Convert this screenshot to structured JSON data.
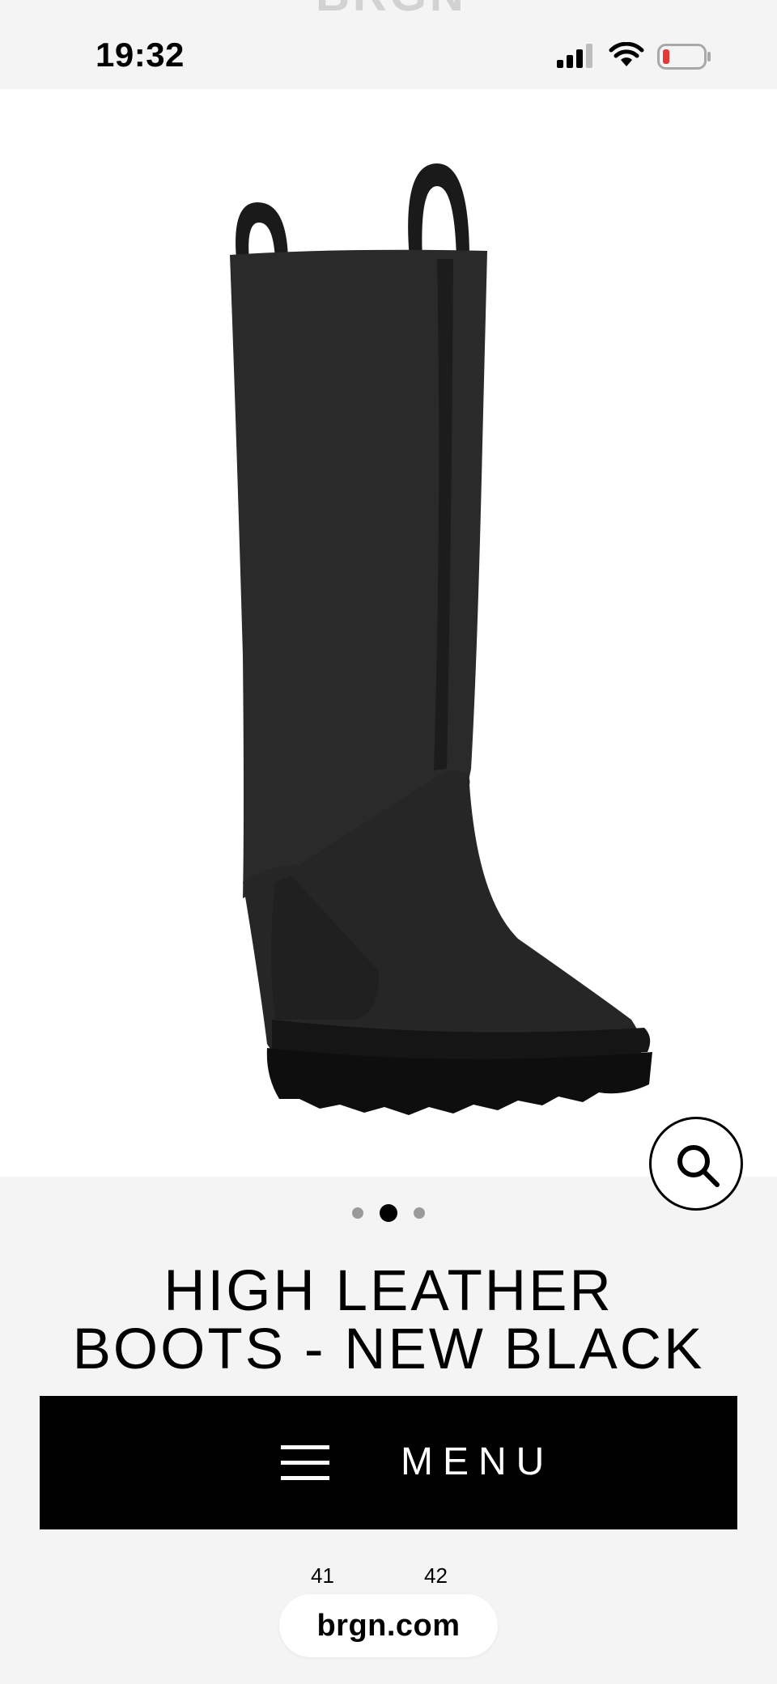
{
  "status_bar": {
    "time": "19:32",
    "brand_peek": "BRGN",
    "battery_color": "#e53935"
  },
  "product": {
    "title_line1": "HIGH LEATHER",
    "title_line2": "BOOTS - NEW BLACK",
    "image_icon": "boot-image",
    "gallery": {
      "count": 3,
      "active_index": 1
    }
  },
  "menu": {
    "label": "MENU",
    "icon": "hamburger-icon"
  },
  "sizes": [
    "41",
    "42"
  ],
  "browser": {
    "url": "brgn.com"
  },
  "colors": {
    "accent": "#000000",
    "background": "#f4f4f4"
  }
}
